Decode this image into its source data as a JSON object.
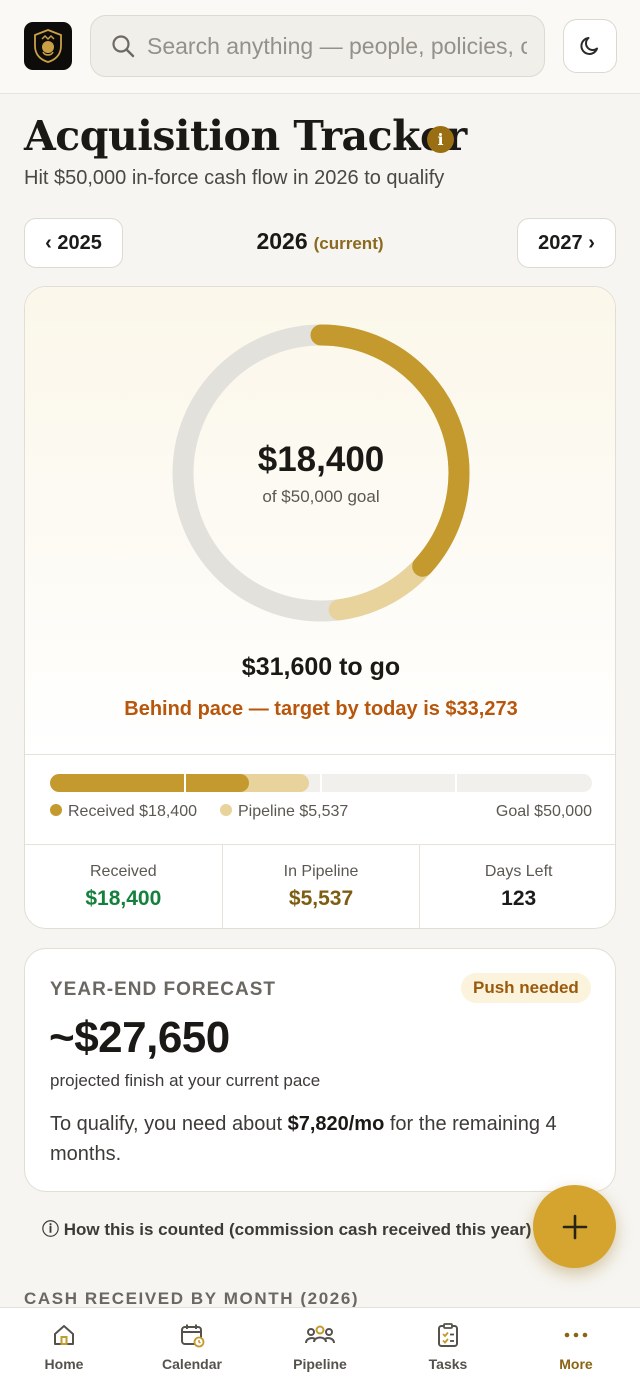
{
  "colors": {
    "gold": "#c49a2e",
    "pipeline": "#e8d39c",
    "received_text": "#15803d",
    "pipeline_text": "#7d5d12",
    "behind_pace": "#b8560c",
    "badge_text": "#9a5a0e"
  },
  "header": {
    "logo_icon": "lion-crest-icon",
    "search_placeholder": "Search anything — people, policies, clients",
    "theme_icon": "moon-icon"
  },
  "page": {
    "title": "Acquisition Tracker",
    "info_icon": "i",
    "subtitle": "Hit $50,000 in-force cash flow in 2026 to qualify"
  },
  "year_nav": {
    "prev_label": "‹ 2025",
    "current_year": "2026",
    "current_tag": "(current)",
    "next_label": "2027 ›"
  },
  "progress": {
    "received": 18400,
    "pipeline": 5537,
    "goal": 50000,
    "amount_label": "$18,400",
    "goal_label": "of $50,000 goal",
    "to_go": "$31,600 to go",
    "pace_text": "Behind pace — target by today is $33,273"
  },
  "bar_legend": {
    "received": "Received $18,400",
    "pipeline": "Pipeline $5,537",
    "goal": "Goal $50,000"
  },
  "stats": [
    {
      "label": "Received",
      "value": "$18,400"
    },
    {
      "label": "In Pipeline",
      "value": "$5,537"
    },
    {
      "label": "Days Left",
      "value": "123"
    }
  ],
  "forecast": {
    "label": "YEAR-END FORECAST",
    "badge": "Push needed",
    "amount": "~$27,650",
    "sub": "projected finish at your current pace",
    "note_prefix": "To qualify, you need about ",
    "note_bold": "$7,820/mo",
    "note_suffix": " for the remaining 4 months."
  },
  "how_counted": "ⓘ How this is counted (commission cash received this year)",
  "section_heading": "CASH RECEIVED BY MONTH (2026)",
  "bottom_nav": [
    {
      "label": "Home",
      "icon": "home-icon"
    },
    {
      "label": "Calendar",
      "icon": "calendar-icon"
    },
    {
      "label": "Pipeline",
      "icon": "people-icon"
    },
    {
      "label": "Tasks",
      "icon": "clipboard-icon"
    },
    {
      "label": "More",
      "icon": "more-dots-icon",
      "active": true
    }
  ]
}
